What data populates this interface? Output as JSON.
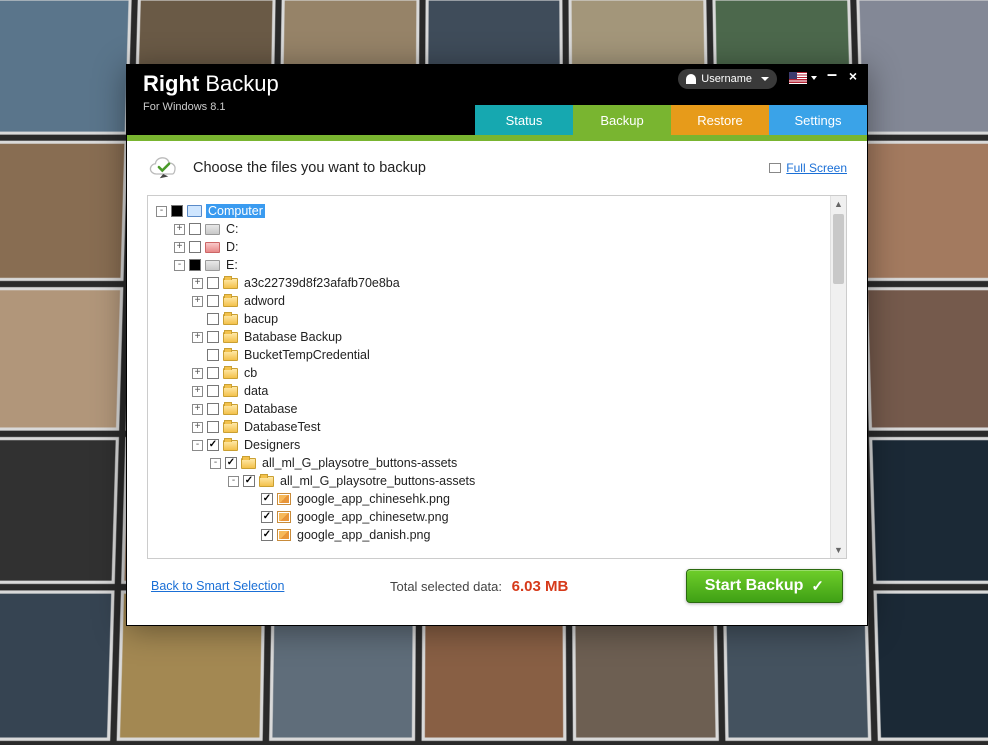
{
  "app": {
    "brand_bold": "Right",
    "brand_light": "Backup",
    "subtitle": "For Windows 8.1"
  },
  "user": {
    "label": "Username"
  },
  "tabs": {
    "status": "Status",
    "backup": "Backup",
    "restore": "Restore",
    "settings": "Settings",
    "active": "backup"
  },
  "body": {
    "heading": "Choose the files you want to backup",
    "fullscreen": "Full Screen"
  },
  "footer": {
    "back_link": "Back to Smart Selection",
    "total_label": "Total selected data:",
    "total_size": "6.03 MB",
    "start_button": "Start Backup"
  },
  "tree": [
    {
      "depth": 0,
      "expander": "-",
      "check": "mix",
      "icon": "comp",
      "label": "Computer",
      "selected": true
    },
    {
      "depth": 1,
      "expander": "+",
      "check": "off",
      "icon": "drive",
      "label": "C:"
    },
    {
      "depth": 1,
      "expander": "+",
      "check": "off",
      "icon": "drive red",
      "label": "D:"
    },
    {
      "depth": 1,
      "expander": "-",
      "check": "mix",
      "icon": "drive",
      "label": "E:"
    },
    {
      "depth": 2,
      "expander": "+",
      "check": "off",
      "icon": "folder",
      "label": "a3c22739d8f23afafb70e8ba"
    },
    {
      "depth": 2,
      "expander": "+",
      "check": "off",
      "icon": "folder",
      "label": "adword"
    },
    {
      "depth": 2,
      "expander": "",
      "check": "off",
      "icon": "folder",
      "label": "bacup"
    },
    {
      "depth": 2,
      "expander": "+",
      "check": "off",
      "icon": "folder",
      "label": "Batabase Backup"
    },
    {
      "depth": 2,
      "expander": "",
      "check": "off",
      "icon": "folder",
      "label": "BucketTempCredential"
    },
    {
      "depth": 2,
      "expander": "+",
      "check": "off",
      "icon": "folder",
      "label": "cb"
    },
    {
      "depth": 2,
      "expander": "+",
      "check": "off",
      "icon": "folder",
      "label": "data"
    },
    {
      "depth": 2,
      "expander": "+",
      "check": "off",
      "icon": "folder",
      "label": "Database"
    },
    {
      "depth": 2,
      "expander": "+",
      "check": "off",
      "icon": "folder",
      "label": "DatabaseTest"
    },
    {
      "depth": 2,
      "expander": "-",
      "check": "on",
      "icon": "folder",
      "label": "Designers"
    },
    {
      "depth": 3,
      "expander": "-",
      "check": "on",
      "icon": "folder",
      "label": "all_ml_G_playsotre_buttons-assets"
    },
    {
      "depth": 4,
      "expander": "-",
      "check": "on",
      "icon": "folder",
      "label": "all_ml_G_playsotre_buttons-assets"
    },
    {
      "depth": 5,
      "expander": "",
      "check": "on",
      "icon": "png",
      "label": "google_app_chinesehk.png"
    },
    {
      "depth": 5,
      "expander": "",
      "check": "on",
      "icon": "png",
      "label": "google_app_chinesetw.png"
    },
    {
      "depth": 5,
      "expander": "",
      "check": "on",
      "icon": "png",
      "label": "google_app_danish.png"
    }
  ]
}
